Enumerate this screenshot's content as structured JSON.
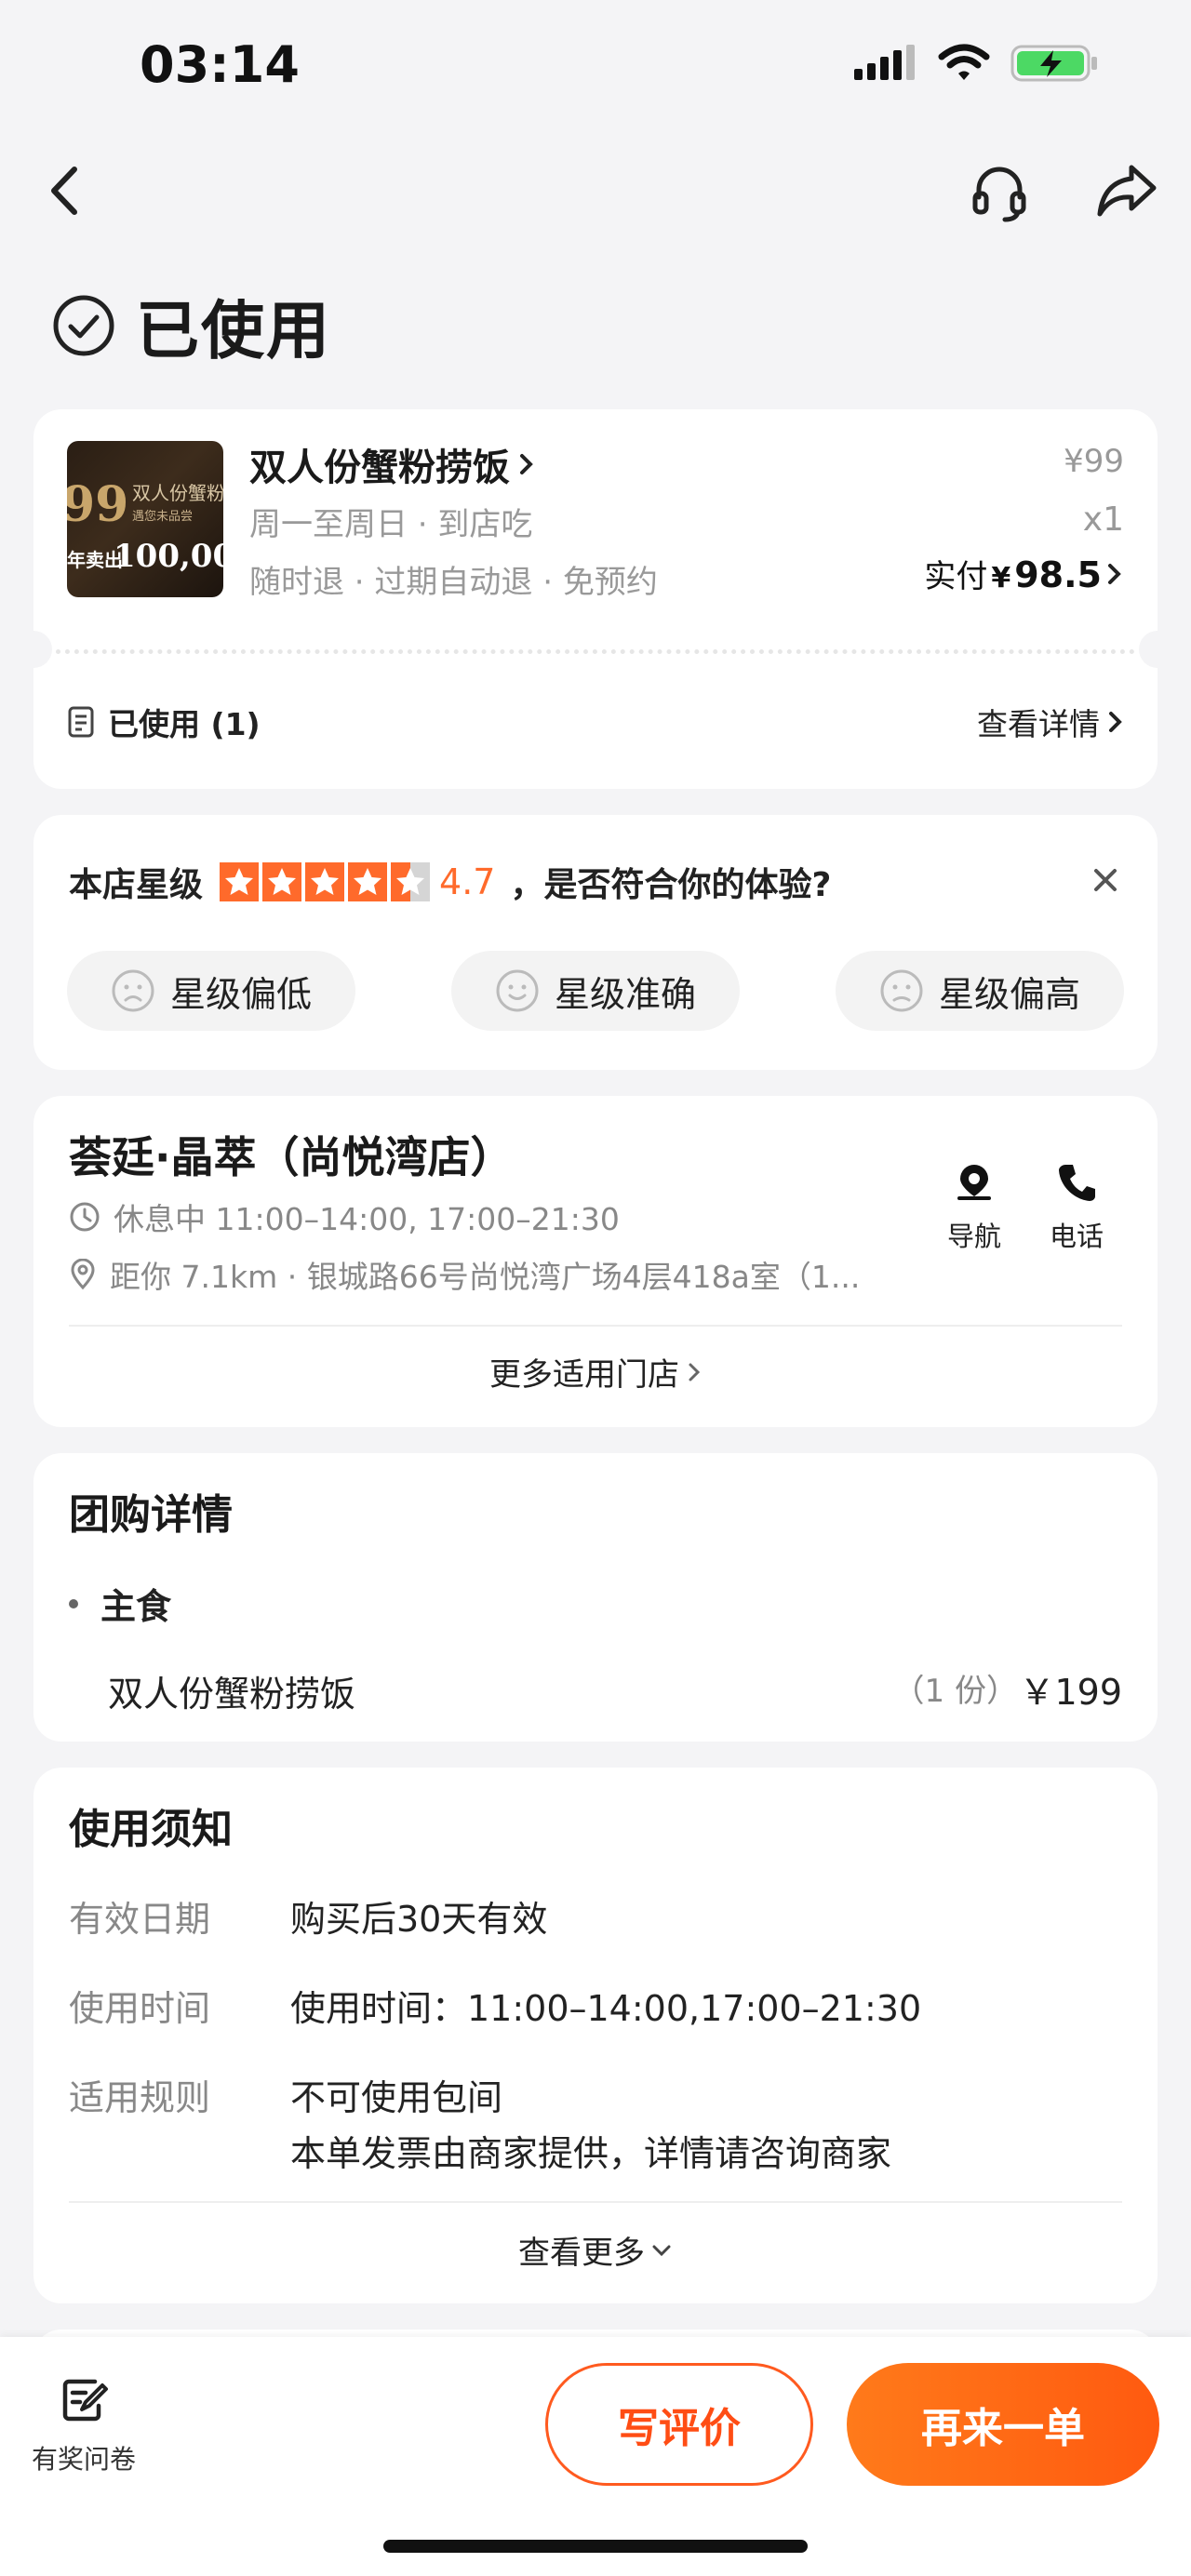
{
  "status_bar": {
    "time": "03:14"
  },
  "order_status": {
    "title": "已使用"
  },
  "order": {
    "thumb_big": "99",
    "thumb_brand": "双人份蟹粉",
    "thumb_tag": "遇您未品尝",
    "thumb_year": "年卖出",
    "thumb_count": "100,00",
    "product_name": "双人份蟹粉捞饭",
    "subtitle_1": "周一至周日 · 到店吃",
    "subtitle_2": "随时退 · 过期自动退 · 免预约",
    "original_price": "¥99",
    "quantity": "x1",
    "paid_label": "实付",
    "paid_currency": "¥",
    "paid_amount": "98.5",
    "used_label": "已使用 (1)",
    "view_details": "查看详情"
  },
  "rating": {
    "label": "本店星级",
    "stars": 4.7,
    "score": "4.7",
    "question": "，是否符合你的体验?",
    "options": [
      "星级偏低",
      "星级准确",
      "星级偏高"
    ]
  },
  "shop": {
    "name": "荟廷·晶萃（尚悦湾店）",
    "hours": "休息中 11:00–14:00, 17:00–21:30",
    "address": "距你 7.1km ·  银城路66号尚悦湾广场4层418a室（1...",
    "nav_label": "导航",
    "phone_label": "电话",
    "more_shops": "更多适用门店"
  },
  "deal": {
    "title": "团购详情",
    "category": "主食",
    "item_name": "双人份蟹粉捞饭",
    "item_qty": "（1 份）",
    "item_price": "￥199"
  },
  "notes": {
    "title": "使用须知",
    "rows": [
      {
        "label": "有效日期",
        "value": "购买后30天有效"
      },
      {
        "label": "使用时间",
        "value": "使用时间：11:00–14:00,17:00–21:30"
      },
      {
        "label": "适用规则",
        "value": "不可使用包间",
        "value2": "本单发票由商家提供，详情请咨询商家"
      }
    ],
    "see_more": "查看更多"
  },
  "bottom": {
    "survey_label": "有奖问卷",
    "review_button": "写评价",
    "reorder_button": "再来一单"
  },
  "colors": {
    "accent": "#ff5a1f",
    "star": "#ff6a2b",
    "battery": "#4cd964"
  }
}
